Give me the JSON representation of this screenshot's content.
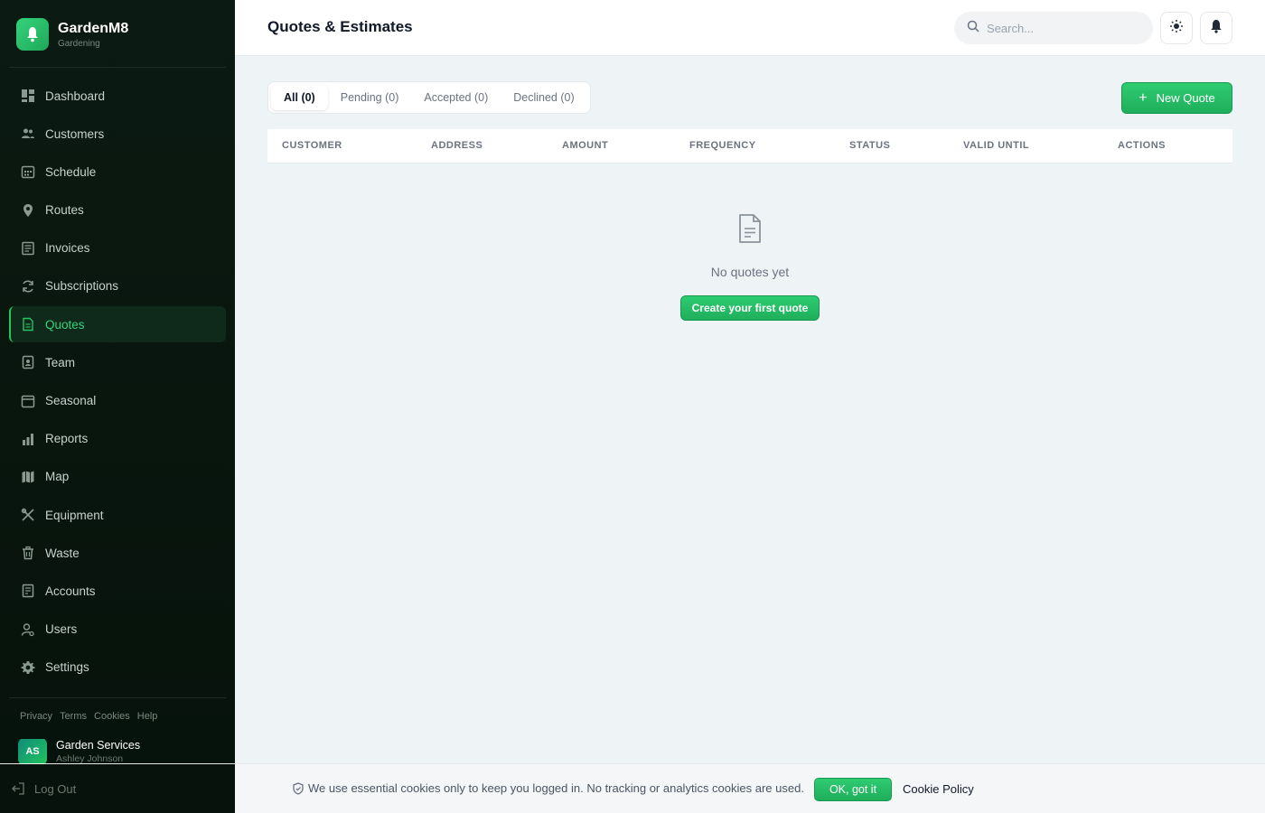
{
  "brand": {
    "name": "GardenM8",
    "subtitle": "Gardening",
    "logo_icon": "bell-icon"
  },
  "sidebar": {
    "items": [
      {
        "label": "Dashboard",
        "icon": "dashboard-icon"
      },
      {
        "label": "Customers",
        "icon": "users-icon"
      },
      {
        "label": "Schedule",
        "icon": "calendar-icon"
      },
      {
        "label": "Routes",
        "icon": "map-pin-icon"
      },
      {
        "label": "Invoices",
        "icon": "invoice-icon"
      },
      {
        "label": "Subscriptions",
        "icon": "refresh-icon"
      },
      {
        "label": "Quotes",
        "icon": "document-icon",
        "active": true
      },
      {
        "label": "Team",
        "icon": "badge-icon"
      },
      {
        "label": "Seasonal",
        "icon": "calendar-blank-icon"
      },
      {
        "label": "Reports",
        "icon": "bar-chart-icon"
      },
      {
        "label": "Map",
        "icon": "map-icon"
      },
      {
        "label": "Equipment",
        "icon": "tools-icon"
      },
      {
        "label": "Waste",
        "icon": "trash-icon"
      },
      {
        "label": "Accounts",
        "icon": "ledger-icon"
      },
      {
        "label": "Users",
        "icon": "user-settings-icon"
      },
      {
        "label": "Settings",
        "icon": "gear-icon"
      }
    ],
    "footer_links": [
      "Privacy",
      "Terms",
      "Cookies",
      "Help"
    ],
    "user": {
      "initials": "AS",
      "name": "Garden Services",
      "subtitle": "Ashley Johnson"
    },
    "logout_label": "Log Out"
  },
  "header": {
    "title": "Quotes & Estimates",
    "search_placeholder": "Search..."
  },
  "tabs": [
    {
      "label": "All (0)",
      "active": true
    },
    {
      "label": "Pending (0)"
    },
    {
      "label": "Accepted (0)"
    },
    {
      "label": "Declined (0)"
    }
  ],
  "new_quote_label": "New Quote",
  "table": {
    "columns": [
      "CUSTOMER",
      "ADDRESS",
      "AMOUNT",
      "FREQUENCY",
      "STATUS",
      "VALID UNTIL",
      "ACTIONS"
    ]
  },
  "empty_state": {
    "message": "No quotes yet",
    "button_label": "Create your first quote"
  },
  "cookie_banner": {
    "text": "We use essential cookies only to keep you logged in. No tracking or analytics cookies are used.",
    "ok_label": "OK, got it",
    "policy_label": "Cookie Policy"
  },
  "colors": {
    "accent": "#22c55e",
    "sidebar_bg": "#0b1a12"
  }
}
